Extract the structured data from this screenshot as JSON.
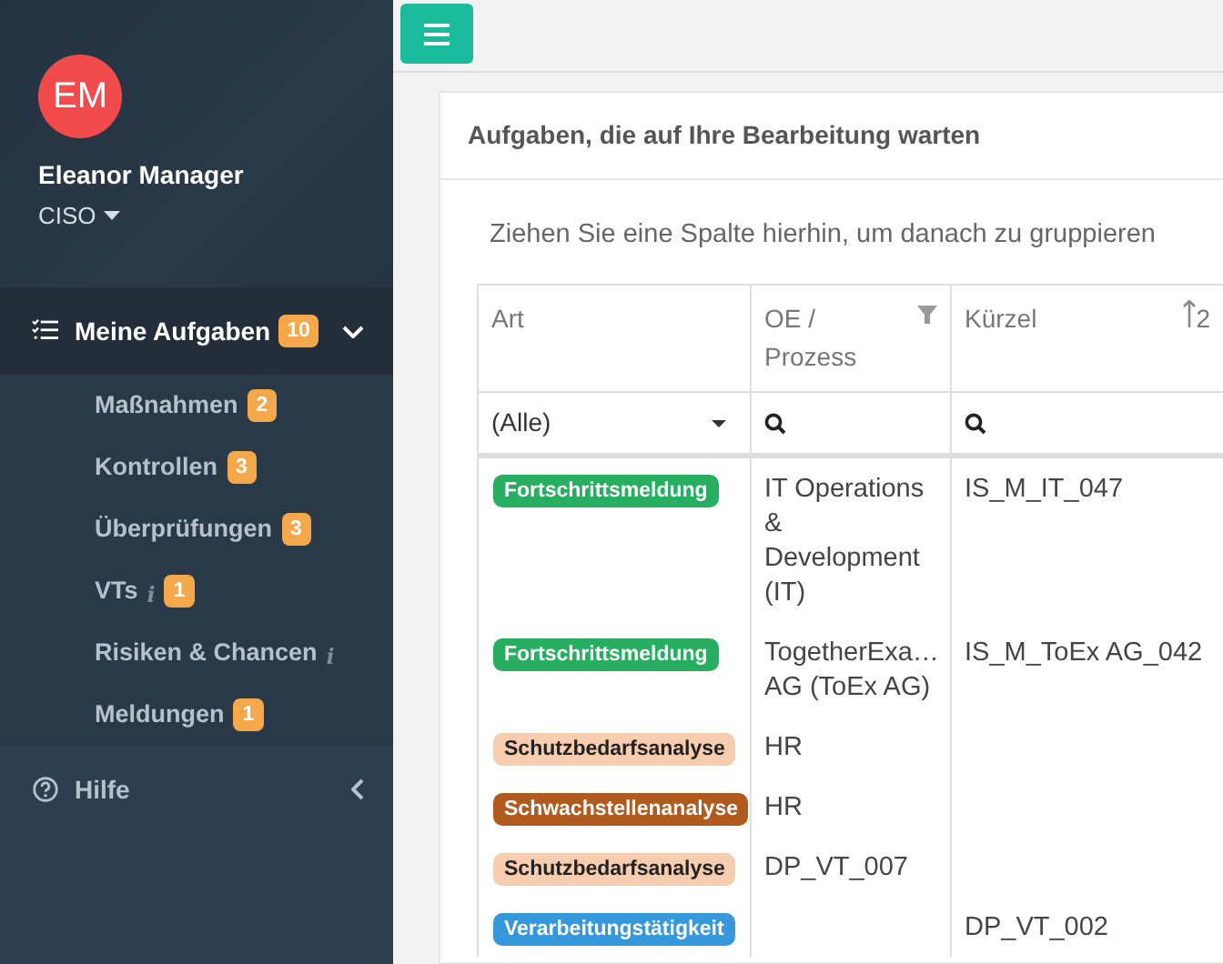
{
  "user": {
    "initials": "EM",
    "name": "Eleanor Manager",
    "role": "CISO"
  },
  "menu": [
    {
      "label": "Meine Aufgaben",
      "badge": "10",
      "expanded": true,
      "children": [
        {
          "label": "Maßnahmen",
          "badge": "2"
        },
        {
          "label": "Kontrollen",
          "badge": "3"
        },
        {
          "label": "Überprüfungen",
          "badge": "3"
        },
        {
          "label": "VTs",
          "info_mark": "i",
          "badge": "1"
        },
        {
          "label": "Risiken & Chancen",
          "info_mark": "i"
        },
        {
          "label": "Meldungen",
          "badge": "1"
        }
      ]
    },
    {
      "label": "Hilfe",
      "expanded": false
    }
  ],
  "card": {
    "title": "Aufgaben, die auf Ihre Bearbeitung warten",
    "group_panel": "Ziehen Sie eine Spalte hierhin, um danach zu gruppieren",
    "table": {
      "columns": [
        {
          "label": "Art"
        },
        {
          "label": "OE / Prozess",
          "filtered": true
        },
        {
          "label": "Kürzel",
          "sort_order": "2"
        }
      ],
      "filters": [
        {
          "kind": "select",
          "value": "(Alle)"
        },
        {
          "kind": "search"
        },
        {
          "kind": "search"
        }
      ],
      "rows": [
        {
          "art": {
            "label": "Fortschrittsmeldung",
            "color": "#27ae60"
          },
          "oe": "IT Operations & Development (IT)",
          "kuerzel": "IS_M_IT_047"
        },
        {
          "art": {
            "label": "Fortschrittsmeldung",
            "color": "#27ae60"
          },
          "oe": "TogetherExa… AG (ToEx AG)",
          "kuerzel": "IS_M_ToEx AG_042"
        },
        {
          "art": {
            "label": "Schutzbedarfsanalyse",
            "color": "#f7cdb0"
          },
          "oe": "HR"
        },
        {
          "art": {
            "label": "Schwachstellenanalyse",
            "color": "#b05a1e"
          },
          "oe": "HR"
        },
        {
          "art": {
            "label": "Schutzbedarfsanalyse",
            "color": "#f7cdb0"
          },
          "oe": "DP_VT_007"
        },
        {
          "art": {
            "label": "Verarbeitungstätigkeit",
            "color": "#3498db"
          },
          "kuerzel": "DP_VT_002"
        }
      ]
    }
  }
}
